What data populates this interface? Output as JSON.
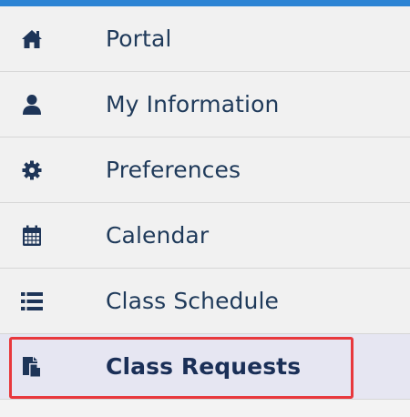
{
  "nav": {
    "items": [
      {
        "label": "Portal",
        "icon": "home-icon"
      },
      {
        "label": "My Information",
        "icon": "user-icon"
      },
      {
        "label": "Preferences",
        "icon": "gear-icon"
      },
      {
        "label": "Calendar",
        "icon": "calendar-icon"
      },
      {
        "label": "Class Schedule",
        "icon": "list-icon"
      },
      {
        "label": "Class Requests",
        "icon": "documents-icon",
        "active": true
      }
    ]
  },
  "colors": {
    "accent": "#2d84d4",
    "icon": "#1e3558",
    "highlight_border": "#e8383d",
    "active_background": "#e6e6f2"
  }
}
